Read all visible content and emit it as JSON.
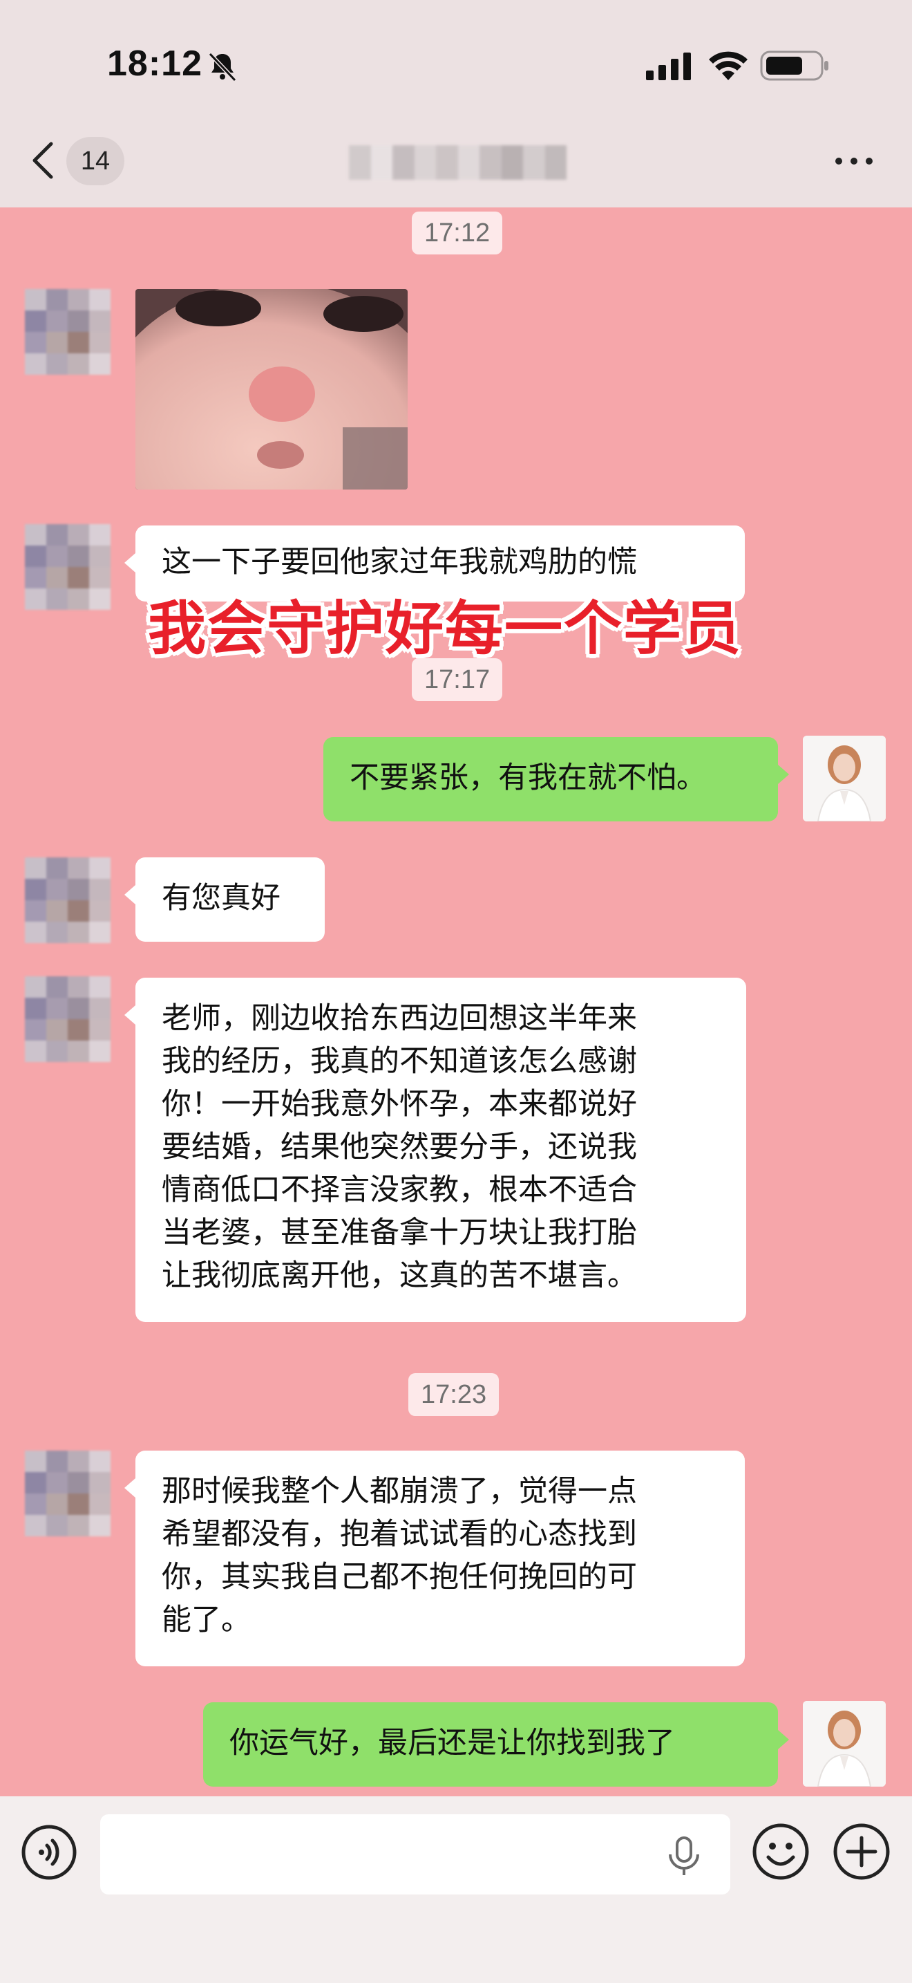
{
  "status_bar": {
    "time": "18:12",
    "icons": [
      "bell-slash-icon",
      "signal-icon",
      "wifi-icon",
      "battery-icon"
    ]
  },
  "nav": {
    "unread_count": "14",
    "chat_title": "",
    "icons": [
      "chevron-left-icon",
      "more-icon"
    ]
  },
  "overlay_caption": "我会守护好每一个学员",
  "timestamps": [
    "17:12",
    "17:17",
    "17:23"
  ],
  "messages": [
    {
      "side": "in",
      "type": "sticker",
      "text": ""
    },
    {
      "side": "in",
      "type": "text",
      "text": "这一下子要回他家过年我就鸡肋的慌"
    },
    {
      "side": "out",
      "type": "text",
      "text": "不要紧张，有我在就不怕。"
    },
    {
      "side": "in",
      "type": "text",
      "text": "有您真好"
    },
    {
      "side": "in",
      "type": "text",
      "lines": [
        "老师，刚边收拾东西边回想这半年来",
        "我的经历，我真的不知道该怎么感谢",
        "你！一开始我意外怀孕，本来都说好",
        "要结婚，结果他突然要分手，还说我",
        "情商低口不择言没家教，根本不适合",
        "当老婆，甚至准备拿十万块让我打胎",
        "让我彻底离开他，这真的苦不堪言。"
      ]
    },
    {
      "side": "in",
      "type": "text",
      "lines": [
        "那时候我整个人都崩溃了，觉得一点",
        "希望都没有，抱着试试看的心态找到",
        "你，其实我自己都不抱任何挽回的可",
        "能了。"
      ]
    },
    {
      "side": "out",
      "type": "text",
      "text": "你运气好，最后还是让你找到我了"
    }
  ],
  "input_bar": {
    "value": "",
    "icons": [
      "voice-icon",
      "mic-icon",
      "emoji-icon",
      "plus-icon"
    ]
  },
  "colors": {
    "chat_background": "#f6a6aa",
    "outgoing_bubble": "#8fe06a",
    "incoming_bubble": "#ffffff",
    "caption_red": "#e8202a"
  }
}
